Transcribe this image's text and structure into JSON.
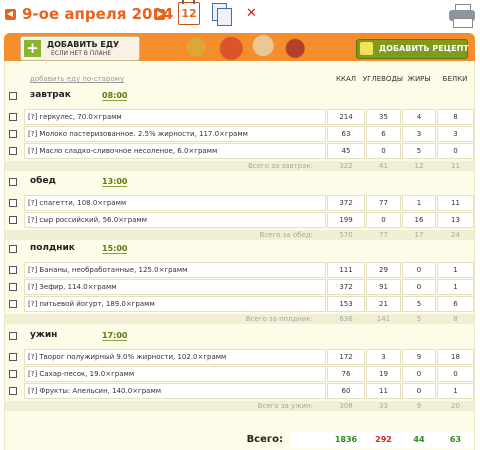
{
  "header": {
    "date_title": "9-ое апреля 2014",
    "calendar_day": "12"
  },
  "banner": {
    "add_food_line1": "ДОБАВИТЬ ЕДУ",
    "add_food_line2": "ЕСЛИ НЕТ В ПЛАНЕ",
    "add_recipe": "ДОБАВИТЬ РЕЦЕПТ"
  },
  "table": {
    "old_link": "добавить еду по-старому",
    "columns": [
      "ККАЛ",
      "УГЛЕВОДЫ",
      "ЖИРЫ",
      "БЕЛКИ"
    ],
    "meals": [
      {
        "name": "завтрак",
        "time": "08:00",
        "items": [
          {
            "desc": "[?] геркулес, 70.0×грамм",
            "vals": [
              "214",
              "35",
              "4",
              "8"
            ]
          },
          {
            "desc": "[?] Молоко пастеризованное. 2.5% жирности, 117.0×грамм",
            "vals": [
              "63",
              "6",
              "3",
              "3"
            ]
          },
          {
            "desc": "[?] Масло сладко-сливочное несоленое, 6.0×грамм",
            "vals": [
              "45",
              "0",
              "5",
              "0"
            ]
          }
        ],
        "total_label": "Всего за завтрак:",
        "totals": [
          "322",
          "41",
          "12",
          "11"
        ]
      },
      {
        "name": "обед",
        "time": "13:00",
        "items": [
          {
            "desc": "[?] спагетти, 108.0×грамм",
            "vals": [
              "372",
              "77",
              "1",
              "11"
            ]
          },
          {
            "desc": "[?] сыр российский, 56.0×грамм",
            "vals": [
              "199",
              "0",
              "16",
              "13"
            ]
          }
        ],
        "total_label": "Всего за обед:",
        "totals": [
          "570",
          "77",
          "17",
          "24"
        ]
      },
      {
        "name": "полдник",
        "time": "15:00",
        "items": [
          {
            "desc": "[?] Бананы, необработанные, 125.0×грамм",
            "vals": [
              "111",
              "29",
              "0",
              "1"
            ]
          },
          {
            "desc": "[?] Зефир, 114.0×грамм",
            "vals": [
              "372",
              "91",
              "0",
              "1"
            ]
          },
          {
            "desc": "[?] питьевой йогурт, 189.0×грамм",
            "vals": [
              "153",
              "21",
              "5",
              "6"
            ]
          }
        ],
        "total_label": "Всего за полдник:",
        "totals": [
          "636",
          "141",
          "5",
          "8"
        ]
      },
      {
        "name": "ужин",
        "time": "17:00",
        "items": [
          {
            "desc": "[?] Творог полужирный 9.0% жирности, 102.0×грамм",
            "vals": [
              "172",
              "3",
              "9",
              "18"
            ]
          },
          {
            "desc": "[?] Сахар-песок, 19.0×грамм",
            "vals": [
              "76",
              "19",
              "0",
              "0"
            ]
          },
          {
            "desc": "[?] Фрукты: Апельсин, 140.0×грамм",
            "vals": [
              "60",
              "11",
              "0",
              "1"
            ]
          }
        ],
        "total_label": "Всего за ужин:",
        "totals": [
          "308",
          "33",
          "9",
          "20"
        ]
      }
    ],
    "grand_label": "Всего:",
    "grand_totals": [
      "1836",
      "292",
      "44",
      "63"
    ],
    "grand_colors": [
      "#2e8b1a",
      "#d8261c",
      "#2e8b1a",
      "#2e8b1a"
    ]
  }
}
